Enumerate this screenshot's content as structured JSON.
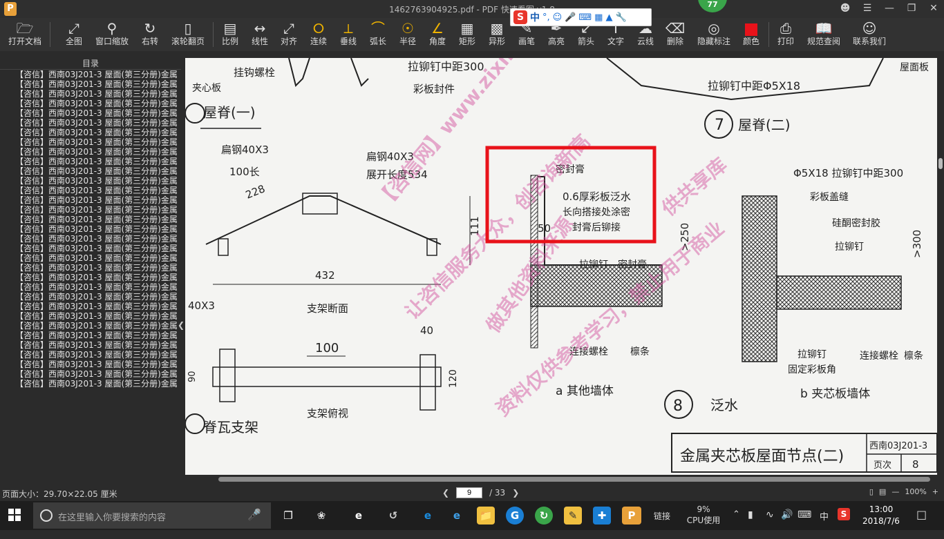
{
  "titlebar": {
    "logo": "P",
    "title": "1462763904925.pdf - PDF 快速看图 v1.8",
    "badge": "77",
    "controls": [
      "person-icon",
      "menu-icon",
      "minimize-icon",
      "maximize-icon",
      "close-icon"
    ]
  },
  "ime": {
    "logo": "S",
    "mode": "中",
    "punct": "°,",
    "icons": [
      "smiley-icon",
      "mic-icon",
      "keyboard-icon",
      "grid-icon",
      "shirt-icon",
      "wrench-icon"
    ]
  },
  "toolbar": {
    "items": [
      {
        "label": "打开文档",
        "icon": "folder-icon"
      },
      {
        "label": "全图",
        "icon": "fullview-icon"
      },
      {
        "label": "窗口缩放",
        "icon": "zoom-window-icon"
      },
      {
        "label": "右转",
        "icon": "rotate-right-icon"
      },
      {
        "label": "滚轮翻页",
        "icon": "mouse-wheel-icon"
      },
      {
        "label": "比例",
        "icon": "scale-icon"
      },
      {
        "label": "线性",
        "icon": "linear-dim-icon"
      },
      {
        "label": "对齐",
        "icon": "aligned-dim-icon"
      },
      {
        "label": "连续",
        "icon": "continuous-dim-icon"
      },
      {
        "label": "垂线",
        "icon": "perpendicular-icon"
      },
      {
        "label": "弧长",
        "icon": "arc-length-icon"
      },
      {
        "label": "半径",
        "icon": "radius-icon"
      },
      {
        "label": "角度",
        "icon": "angle-icon"
      },
      {
        "label": "矩形",
        "icon": "rectangle-area-icon"
      },
      {
        "label": "异形",
        "icon": "polygon-area-icon"
      },
      {
        "label": "画笔",
        "icon": "pen-icon"
      },
      {
        "label": "高亮",
        "icon": "highlight-icon"
      },
      {
        "label": "箭头",
        "icon": "arrow-icon"
      },
      {
        "label": "文字",
        "icon": "text-icon"
      },
      {
        "label": "云线",
        "icon": "cloud-line-icon"
      },
      {
        "label": "删除",
        "icon": "eraser-icon"
      },
      {
        "label": "隐藏标注",
        "icon": "hide-eye-icon"
      },
      {
        "label": "颜色",
        "icon": "color-swatch-icon"
      },
      {
        "label": "打印",
        "icon": "printer-icon"
      },
      {
        "label": "规范查阅",
        "icon": "book-icon"
      },
      {
        "label": "联系我们",
        "icon": "support-icon"
      }
    ],
    "color_swatch": "#e8121a"
  },
  "sidebar": {
    "title": "目录",
    "items": [
      "【咨信】西南03J201-3 屋面(第三分册)金属",
      "【咨信】西南03J201-3 屋面(第三分册)金属",
      "【咨信】西南03J201-3 屋面(第三分册)金属",
      "【咨信】西南03J201-3 屋面(第三分册)金属",
      "【咨信】西南03J201-3 屋面(第三分册)金属",
      "【咨信】西南03J201-3 屋面(第三分册)金属",
      "【咨信】西南03J201-3 屋面(第三分册)金属",
      "【咨信】西南03J201-3 屋面(第三分册)金属",
      "【咨信】西南03J201-3 屋面(第三分册)金属",
      "【咨信】西南03J201-3 屋面(第三分册)金属",
      "【咨信】西南03J201-3 屋面(第三分册)金属",
      "【咨信】西南03J201-3 屋面(第三分册)金属",
      "【咨信】西南03J201-3 屋面(第三分册)金属",
      "【咨信】西南03J201-3 屋面(第三分册)金属",
      "【咨信】西南03J201-3 屋面(第三分册)金属",
      "【咨信】西南03J201-3 屋面(第三分册)金属",
      "【咨信】西南03J201-3 屋面(第三分册)金属",
      "【咨信】西南03J201-3 屋面(第三分册)金属",
      "【咨信】西南03J201-3 屋面(第三分册)金属",
      "【咨信】西南03J201-3 屋面(第三分册)金属",
      "【咨信】西南03J201-3 屋面(第三分册)金属",
      "【咨信】西南03J201-3 屋面(第三分册)金属",
      "【咨信】西南03J201-3 屋面(第三分册)金属",
      "【咨信】西南03J201-3 屋面(第三分册)金属",
      "【咨信】西南03J201-3 屋面(第三分册)金属",
      "【咨信】西南03J201-3 屋面(第三分册)金属",
      "【咨信】西南03J201-3 屋面(第三分册)金属",
      "【咨信】西南03J201-3 屋面(第三分册)金属",
      "【咨信】西南03J201-3 屋面(第三分册)金属",
      "【咨信】西南03J201-3 屋面(第三分册)金属",
      "【咨信】西南03J201-3 屋面(第三分册)金属",
      "【咨信】西南03J201-3 屋面(第三分册)金属",
      "【咨信】西南03J201-3 屋面(第三分册)金属"
    ]
  },
  "drawing": {
    "texts": {
      "t_jiaxinban": "夹心板",
      "t_guagou": "挂钩螺栓",
      "t_lamaoding300": "拉铆钉中距300",
      "t_caibanfengjian": "彩板封件",
      "t_lamaoding5x18": "拉铆钉中距Φ5X18",
      "t_wumianban": "屋面板",
      "t_wuji1": "屋脊(一)",
      "t_n7": "7",
      "t_wuji2": "屋脊(二)",
      "t_biangang1": "扁钢40X3",
      "t_100chang": "100长",
      "t_biangang2": "扁钢40X3",
      "t_zhankai": "展开长度534",
      "t_228": "228",
      "t_111": "111",
      "t_432": "432",
      "t_40x3": "40X3",
      "t_zhijiaduanmian": "支架断面",
      "t_100": "100",
      "t_40": "40",
      "t_90": "90",
      "t_120": "120",
      "t_zhijiafushi": "支架俯视",
      "t_jiwazhijia": "脊瓦支架",
      "t_mifenggao": "密封膏",
      "t_fanshui1": "0.6厚彩板泛水",
      "t_fanshui2": "长向搭接处涂密",
      "t_fanshui3": "封膏后铆接",
      "t_50": "50",
      "t_250": ">250",
      "t_lamaoding_mifeng": "拉铆钉—密封膏",
      "t_lianjieluoshuan": "连接螺栓",
      "t_tiaoban": "檩条",
      "t_a_qita": "a 其他墙体",
      "t_n8": "8",
      "t_fanshui": "泛水",
      "t_5x18_300": "Φ5X18 拉铆钉中距300",
      "t_caibangaifeng": "彩板盖缝",
      "t_guitong": "硅酮密封胶",
      "t_lamaoding": "拉铆钉",
      "t_300": ">300",
      "t_lamaoding2": "拉铆钉",
      "t_guding": "固定彩板角",
      "t_lianjieluoshuan2": "连接螺栓",
      "t_tiaoban2": "檩条",
      "t_b_jiaxin": "b 夹芯板墙体",
      "t_title": "金属夹芯板屋面节点(二)",
      "t_code": "西南03J201-3",
      "t_yeci": "页次",
      "t_page": "8"
    },
    "watermarks": [
      "【咨信网】www.zixin.com.cn",
      "让咨信服务大众，创咨询新高",
      "做其他资料来源",
      "资料仅供参考学习，禁止用于商业",
      "供共享库"
    ],
    "highlight_color": "#e8121a"
  },
  "status": {
    "page_size": "页面大小：29.70×22.05 厘米",
    "current_page": "9",
    "total_pages": "/   33",
    "zoom": "100%"
  },
  "taskbar": {
    "search_placeholder": "在这里输入你要搜索的内容",
    "tray": {
      "link": "链接",
      "cpu_pct": "9%",
      "cpu_label": "CPU使用",
      "ime": "中",
      "ime_logo": "S"
    },
    "clock_time": "13:00",
    "clock_date": "2018/7/6"
  }
}
